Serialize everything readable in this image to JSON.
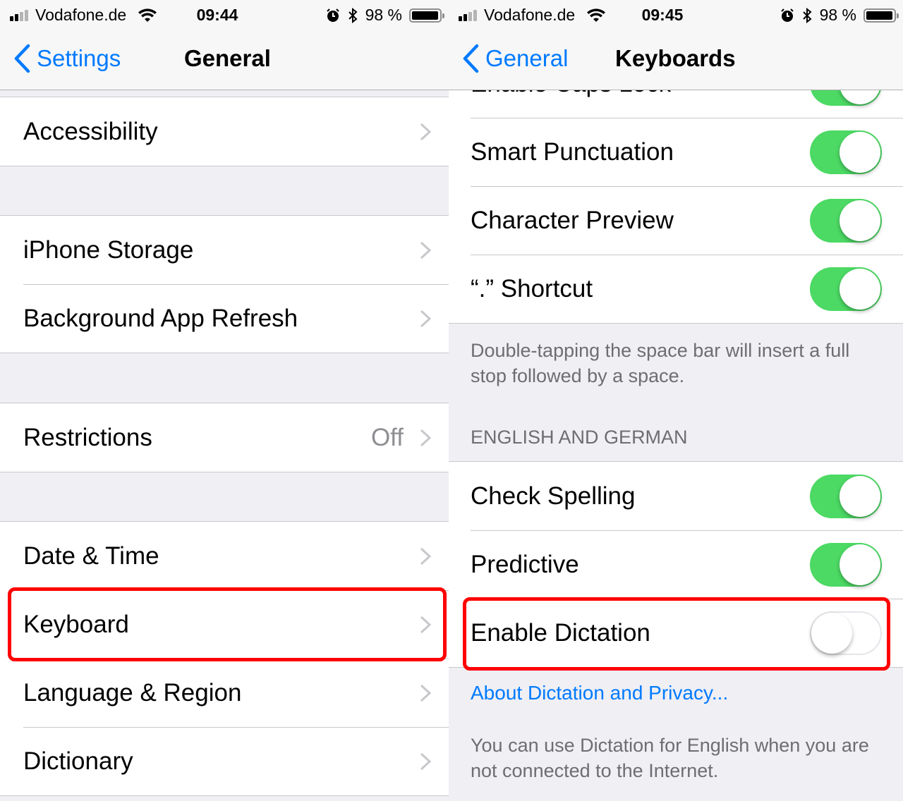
{
  "colors": {
    "accent": "#007aff",
    "toggle_on": "#4cd964",
    "highlight": "#ff0000",
    "background": "#efeff4"
  },
  "left": {
    "status": {
      "carrier": "Vodafone.de",
      "time": "09:44",
      "battery": "98 %",
      "battery_level_percent": 98
    },
    "nav": {
      "back_label": "Settings",
      "title": "General"
    },
    "groups": [
      {
        "rows": [
          {
            "label": "Accessibility",
            "icon": "chevron-right-icon"
          }
        ]
      },
      {
        "rows": [
          {
            "label": "iPhone Storage",
            "icon": "chevron-right-icon"
          },
          {
            "label": "Background App Refresh",
            "icon": "chevron-right-icon"
          }
        ]
      },
      {
        "rows": [
          {
            "label": "Restrictions",
            "detail": "Off",
            "icon": "chevron-right-icon"
          }
        ]
      },
      {
        "rows": [
          {
            "label": "Date & Time",
            "icon": "chevron-right-icon"
          },
          {
            "label": "Keyboard",
            "icon": "chevron-right-icon",
            "highlighted": true
          },
          {
            "label": "Language & Region",
            "icon": "chevron-right-icon"
          },
          {
            "label": "Dictionary",
            "icon": "chevron-right-icon"
          }
        ]
      }
    ]
  },
  "right": {
    "status": {
      "carrier": "Vodafone.de",
      "time": "09:45",
      "battery": "98 %",
      "battery_level_percent": 98
    },
    "nav": {
      "back_label": "General",
      "title": "Keyboards"
    },
    "group1": [
      {
        "label": "Enable Caps Lock",
        "on": true
      },
      {
        "label": "Smart Punctuation",
        "on": true
      },
      {
        "label": "Character Preview",
        "on": true
      },
      {
        "label": "“.” Shortcut",
        "on": true
      }
    ],
    "footer1": "Double-tapping the space bar will insert a full stop followed by a space.",
    "section_header": "ENGLISH AND GERMAN",
    "group2": [
      {
        "label": "Check Spelling",
        "on": true
      },
      {
        "label": "Predictive",
        "on": true
      },
      {
        "label": "Enable Dictation",
        "on": false,
        "highlighted": true
      }
    ],
    "link": "About Dictation and Privacy...",
    "footer2": "You can use Dictation for English when you are not connected to the Internet."
  }
}
